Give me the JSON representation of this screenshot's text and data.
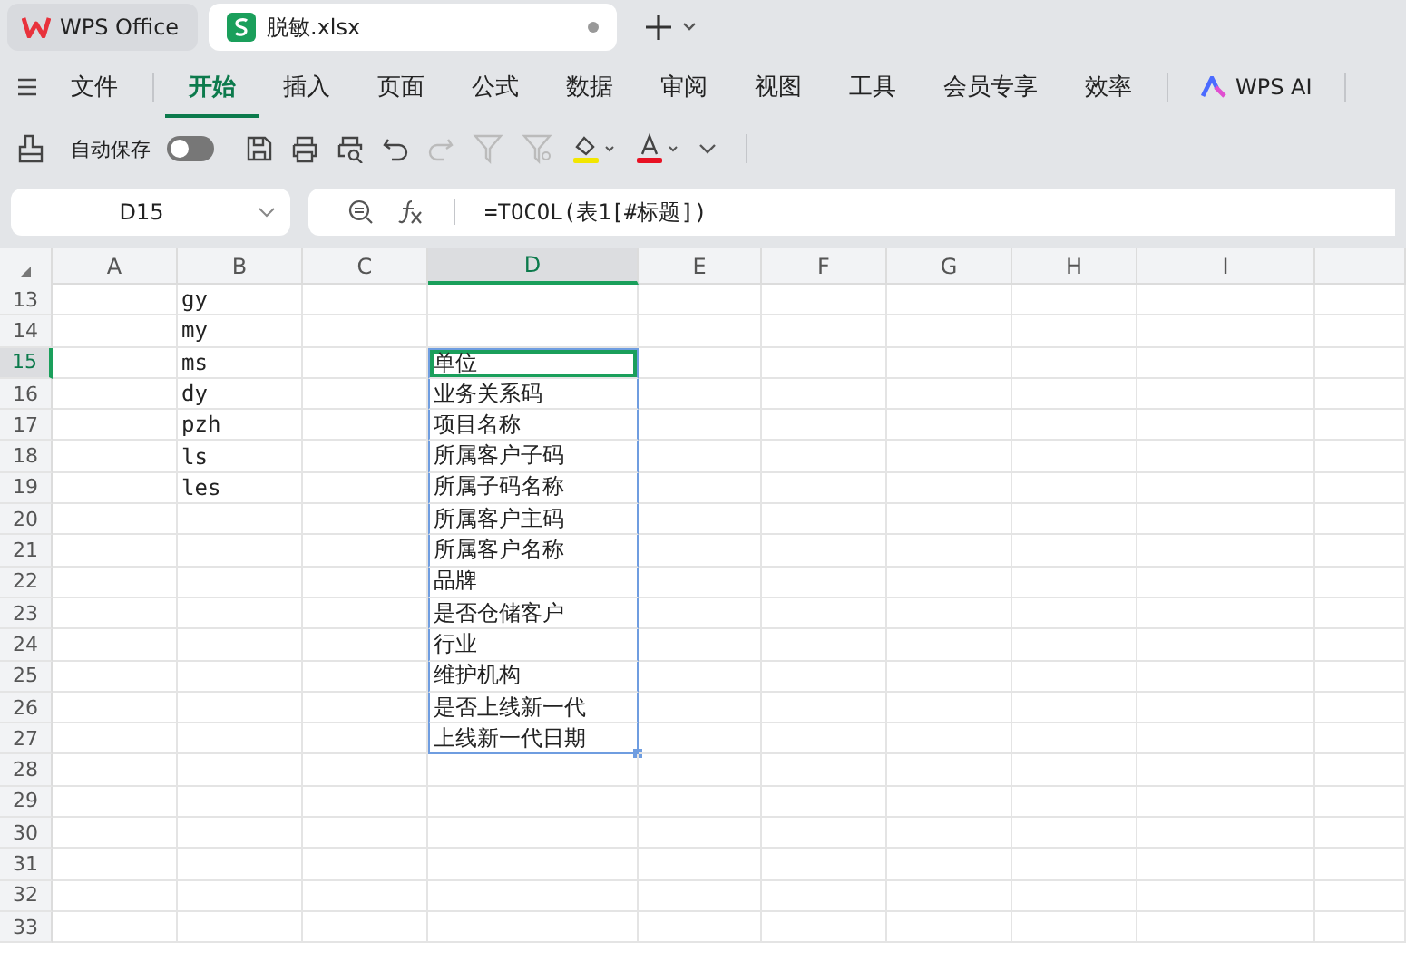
{
  "app_tabs": [
    {
      "label": "WPS Office",
      "kind": "home",
      "selected": false
    },
    {
      "label": "脱敏.xlsx",
      "kind": "file",
      "selected": true
    }
  ],
  "menu": [
    {
      "label": "文件",
      "selected": false
    },
    {
      "label": "开始",
      "selected": true
    },
    {
      "label": "插入",
      "selected": false
    },
    {
      "label": "页面",
      "selected": false
    },
    {
      "label": "公式",
      "selected": false
    },
    {
      "label": "数据",
      "selected": false
    },
    {
      "label": "审阅",
      "selected": false
    },
    {
      "label": "视图",
      "selected": false
    },
    {
      "label": "工具",
      "selected": false
    },
    {
      "label": "会员专享",
      "selected": false
    },
    {
      "label": "效率",
      "selected": false
    }
  ],
  "ai_button": "WPS AI",
  "toolbar": {
    "autosave_label": "自动保存",
    "autosave_on": false
  },
  "name_box": "D15",
  "formula": "=TOCOL(表1[#标题])",
  "columns": [
    {
      "label": "A",
      "selected": false
    },
    {
      "label": "B",
      "selected": false
    },
    {
      "label": "C",
      "selected": false
    },
    {
      "label": "D",
      "selected": true
    },
    {
      "label": "E",
      "selected": false
    },
    {
      "label": "F",
      "selected": false
    },
    {
      "label": "G",
      "selected": false
    },
    {
      "label": "H",
      "selected": false
    },
    {
      "label": "I",
      "selected": false
    }
  ],
  "rows": [
    {
      "label": "13",
      "selected": false,
      "in_range": false,
      "B": "gy"
    },
    {
      "label": "14",
      "selected": false,
      "in_range": false,
      "B": "my"
    },
    {
      "label": "15",
      "selected": true,
      "in_range": true,
      "B": "ms",
      "D": "单位"
    },
    {
      "label": "16",
      "selected": false,
      "in_range": true,
      "B": "dy",
      "D": "业务关系码"
    },
    {
      "label": "17",
      "selected": false,
      "in_range": true,
      "B": "pzh",
      "D": "项目名称"
    },
    {
      "label": "18",
      "selected": false,
      "in_range": true,
      "B": "ls",
      "D": "所属客户子码"
    },
    {
      "label": "19",
      "selected": false,
      "in_range": true,
      "B": "les",
      "D": "所属子码名称"
    },
    {
      "label": "20",
      "selected": false,
      "in_range": true,
      "D": "所属客户主码"
    },
    {
      "label": "21",
      "selected": false,
      "in_range": true,
      "D": "所属客户名称"
    },
    {
      "label": "22",
      "selected": false,
      "in_range": true,
      "D": "品牌"
    },
    {
      "label": "23",
      "selected": false,
      "in_range": true,
      "D": "是否仓储客户"
    },
    {
      "label": "24",
      "selected": false,
      "in_range": true,
      "D": "行业"
    },
    {
      "label": "25",
      "selected": false,
      "in_range": true,
      "D": "维护机构"
    },
    {
      "label": "26",
      "selected": false,
      "in_range": true,
      "D": "是否上线新一代"
    },
    {
      "label": "27",
      "selected": false,
      "in_range": true,
      "D": "上线新一代日期"
    },
    {
      "label": "28",
      "selected": false,
      "in_range": false
    },
    {
      "label": "29",
      "selected": false,
      "in_range": false
    },
    {
      "label": "30",
      "selected": false,
      "in_range": false
    },
    {
      "label": "31",
      "selected": false,
      "in_range": false
    },
    {
      "label": "32",
      "selected": false,
      "in_range": false
    },
    {
      "label": "33",
      "selected": false,
      "in_range": false
    }
  ]
}
